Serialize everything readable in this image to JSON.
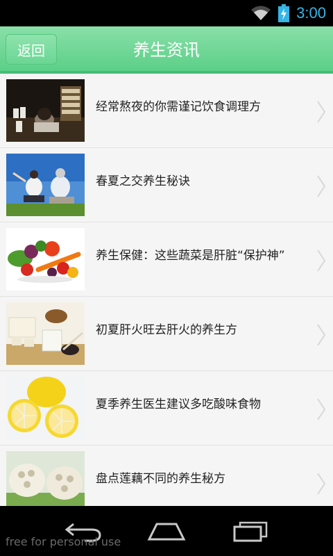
{
  "status_bar": {
    "time": "3:00"
  },
  "header": {
    "back_label": "返回",
    "title": "养生资讯"
  },
  "list": {
    "items": [
      {
        "title": "经常熬夜的你需谨记饮食调理方"
      },
      {
        "title": "春夏之交养生秘诀"
      },
      {
        "title": "养生保健：这些蔬菜是肝脏“保护神”"
      },
      {
        "title": "初夏肝火旺去肝火的养生方"
      },
      {
        "title": "夏季养生医生建议多吃酸味食物"
      },
      {
        "title": "盘点莲藕不同的养生秘方"
      }
    ]
  },
  "watermark": "free for personal use",
  "colors": {
    "header_green": "#5ccf88",
    "time_blue": "#33b5e5"
  }
}
